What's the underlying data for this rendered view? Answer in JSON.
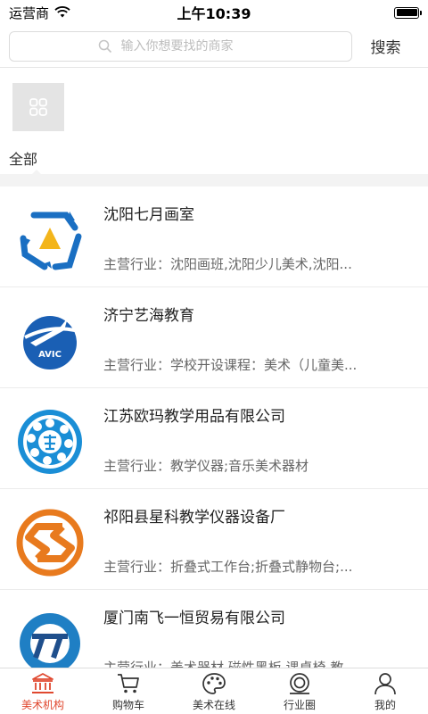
{
  "status_bar": {
    "carrier": "运营商",
    "time": "上午10:39"
  },
  "search": {
    "placeholder": "输入你想要找的商家",
    "button_label": "搜索"
  },
  "category": {
    "label": "全部"
  },
  "merchants": [
    {
      "name": "沈阳七月画室",
      "desc": "主营行业：沈阳画班,沈阳少儿美术,沈阳...",
      "logo": "star-hexagon-logo"
    },
    {
      "name": "济宁艺海教育",
      "desc": "主营行业：学校开设课程：美术（儿童美...",
      "logo": "avic-logo"
    },
    {
      "name": "江苏欧玛教学用品有限公司",
      "desc": "主营行业：教学仪器;音乐美术器材",
      "logo": "bearing-ring-logo"
    },
    {
      "name": "祁阳县星科教学仪器设备厂",
      "desc": "主营行业：折叠式工作台;折叠式静物台;...",
      "logo": "orange-s-logo"
    },
    {
      "name": "厦门南飞一恒贸易有限公司",
      "desc": "主营行业：美术器材,磁性黑板,课桌椅,教...",
      "logo": "blue-ring-logo"
    }
  ],
  "tabs": [
    {
      "label": "美术机构",
      "icon": "institution-icon",
      "active": true
    },
    {
      "label": "购物车",
      "icon": "cart-icon",
      "active": false
    },
    {
      "label": "美术在线",
      "icon": "palette-icon",
      "active": false
    },
    {
      "label": "行业圈",
      "icon": "circle-icon",
      "active": false
    },
    {
      "label": "我的",
      "icon": "user-icon",
      "active": false
    }
  ],
  "colors": {
    "active_tab": "#e0482f",
    "logo_blue": "#1a6fc2",
    "logo_orange": "#e87a1e"
  }
}
